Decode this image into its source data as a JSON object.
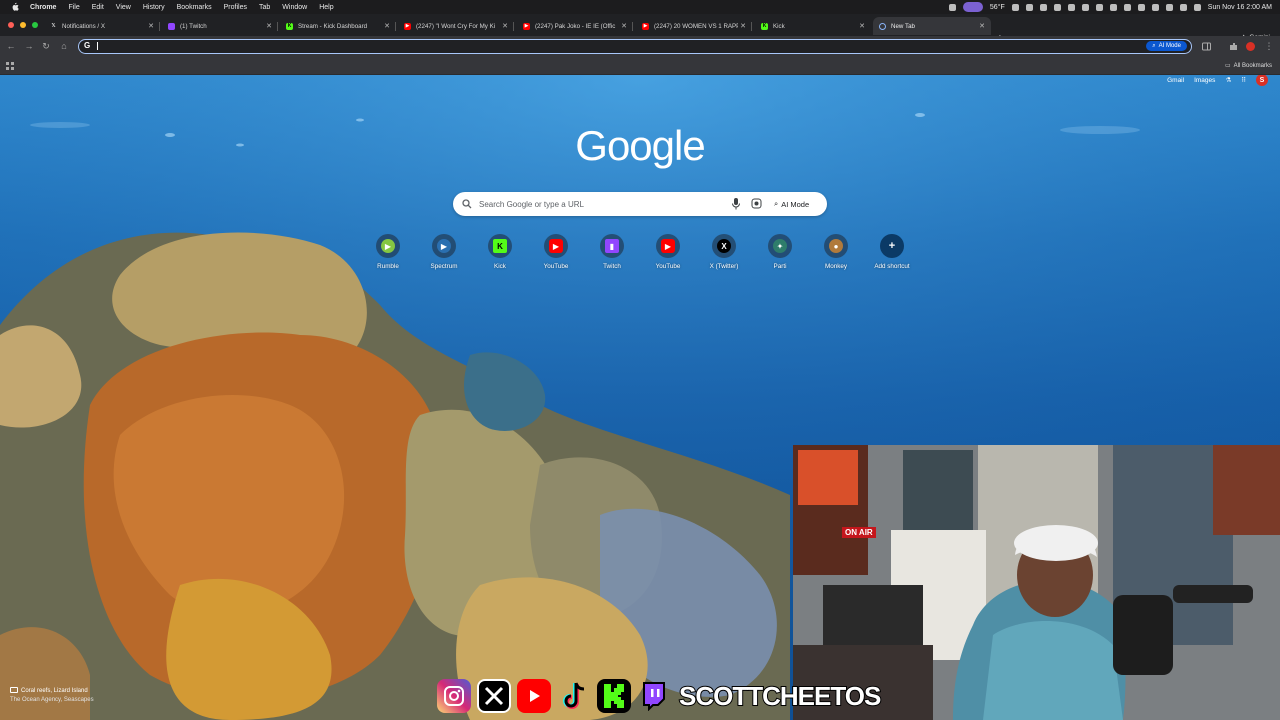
{
  "menubar": {
    "app_name": "Chrome",
    "items": [
      "File",
      "Edit",
      "View",
      "History",
      "Bookmarks",
      "Profiles",
      "Tab",
      "Window",
      "Help"
    ],
    "weather": "56°F",
    "datetime": "Sun Nov 16  2:00 AM"
  },
  "tabs": [
    {
      "label": "Notifications / X",
      "favicon": "x-icon",
      "color": "#000000"
    },
    {
      "label": "(1) Twitch",
      "favicon": "twitch-icon",
      "color": "#9146ff"
    },
    {
      "label": "Stream - Kick Dashboard",
      "favicon": "kick-icon",
      "color": "#53fc18"
    },
    {
      "label": "(2247) \"I Wont Cry For My Ki",
      "favicon": "youtube-icon",
      "color": "#ff0000"
    },
    {
      "label": "(2247) Pak Joko - IE IE (Offic",
      "favicon": "youtube-icon",
      "color": "#ff0000"
    },
    {
      "label": "(2247) 20 WOMEN VS 1 RAPP",
      "favicon": "youtube-icon",
      "color": "#ff0000"
    },
    {
      "label": "Kick",
      "favicon": "kick-icon",
      "color": "#53fc18"
    },
    {
      "label": "New Tab",
      "favicon": "chrome-icon",
      "color": "#8ab4f8",
      "active": true
    }
  ],
  "toolbar": {
    "gemini_label": "Gemini",
    "omnibox_value": "",
    "omnibox_ai_mode": "AI Mode"
  },
  "bookmarks": {
    "all_bookmarks_label": "All Bookmarks"
  },
  "ntp": {
    "top_links": {
      "gmail": "Gmail",
      "images": "Images",
      "avatar_letter": "S"
    },
    "logo": "Google",
    "search_placeholder": "Search Google or type a URL",
    "ai_mode_label": "AI Mode",
    "shortcuts": [
      {
        "label": "Rumble",
        "icon": "rumble-icon",
        "color": "#85c742",
        "glyph": "▶"
      },
      {
        "label": "Spectrum",
        "icon": "spectrum-icon",
        "color": "#2a6fb0",
        "glyph": "▶"
      },
      {
        "label": "Kick",
        "icon": "kick-icon",
        "color": "#53fc18",
        "glyph": "K"
      },
      {
        "label": "YouTube",
        "icon": "youtube-icon",
        "color": "#ff0000",
        "glyph": "▶"
      },
      {
        "label": "Twitch",
        "icon": "twitch-icon",
        "color": "#9146ff",
        "glyph": "▮"
      },
      {
        "label": "YouTube",
        "icon": "youtube-icon",
        "color": "#ff0000",
        "glyph": "▶"
      },
      {
        "label": "X (Twitter)",
        "icon": "x-icon",
        "color": "#000000",
        "glyph": "X"
      },
      {
        "label": "Parti",
        "icon": "parti-icon",
        "color": "#2e7d6b",
        "glyph": "✦"
      },
      {
        "label": "Monkey",
        "icon": "monkey-icon",
        "color": "#b07a3c",
        "glyph": "●"
      },
      {
        "label": "Add shortcut",
        "icon": "plus-icon",
        "color": "#0b3a66",
        "glyph": "+"
      }
    ],
    "photo_credit": {
      "title": "Coral reefs, Lizard Island",
      "author": "The Ocean Agency, Seascapes"
    }
  },
  "overlay": {
    "on_air_sign": "ON AIR",
    "handle": "SCOTTCHEETOS",
    "socials": [
      {
        "icon": "instagram-icon",
        "color": "#d6249f"
      },
      {
        "icon": "x-icon",
        "color": "#000000"
      },
      {
        "icon": "youtube-icon",
        "color": "#ff0000"
      },
      {
        "icon": "tiktok-icon",
        "color": "#000000"
      },
      {
        "icon": "kick-icon",
        "color": "#53fc18"
      },
      {
        "icon": "twitch-icon",
        "color": "#9146ff"
      }
    ]
  }
}
